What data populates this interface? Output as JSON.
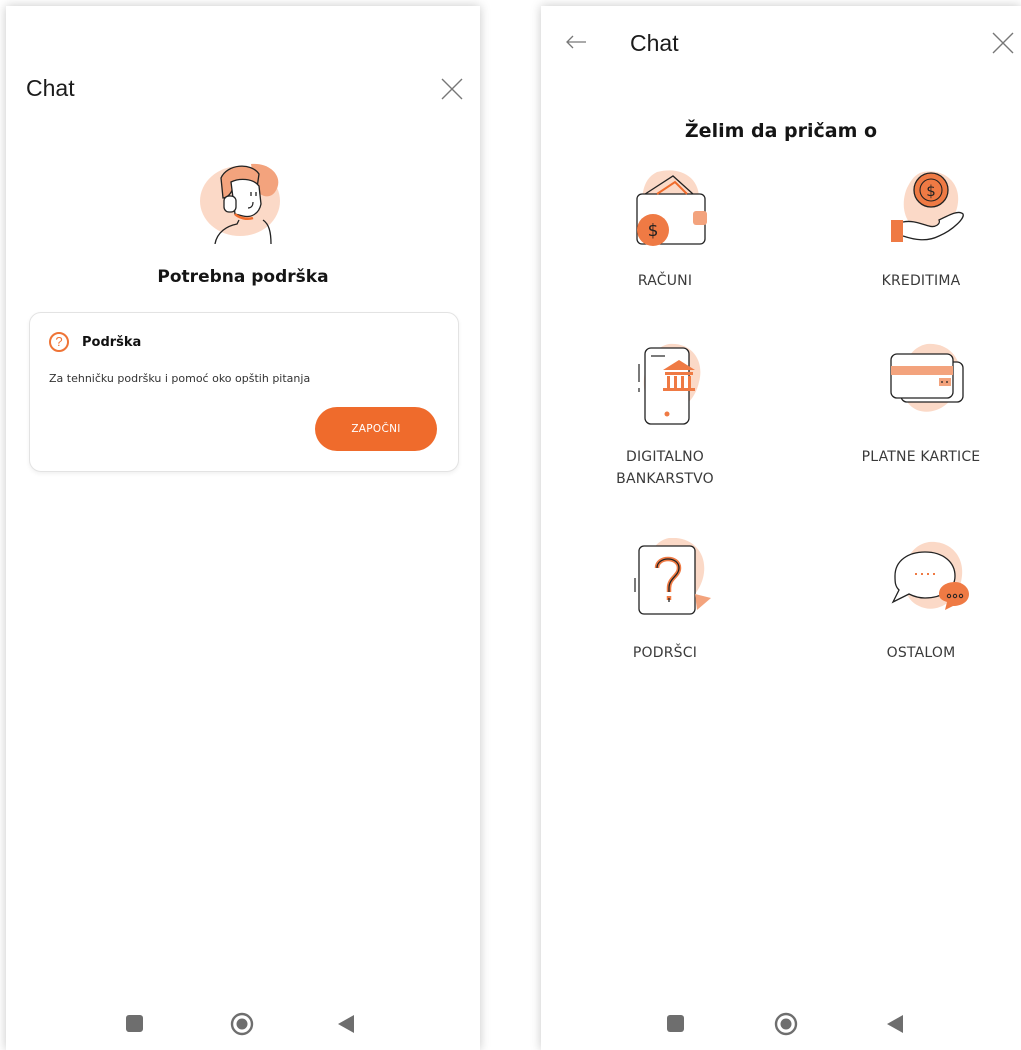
{
  "left_screen": {
    "header": {
      "title": "Chat"
    },
    "headline": "Potrebna podrška",
    "card": {
      "icon_text": "?",
      "title": "Podrška",
      "description": "Za tehničku podršku i pomoć oko opštih pitanja",
      "button_label": "ZAPOČNI"
    }
  },
  "right_screen": {
    "header": {
      "title": "Chat"
    },
    "headline": "Želim da pričam o",
    "topics": [
      {
        "label": "RAČUNI",
        "icon": "wallet-icon"
      },
      {
        "label": "KREDITIMA",
        "icon": "coin-hand-icon"
      },
      {
        "label": "DIGITALNO BANKARSTVO",
        "icon": "mobile-bank-icon"
      },
      {
        "label": "PLATNE KARTICE",
        "icon": "credit-card-icon"
      },
      {
        "label": "PODRŠCI",
        "icon": "question-icon"
      },
      {
        "label": "OSTALOM",
        "icon": "chat-bubble-icon"
      }
    ]
  },
  "icons": {
    "close": "close-icon",
    "back": "back-arrow-icon",
    "nav_recents": "square-icon",
    "nav_home": "circle-icon",
    "nav_back": "triangle-icon"
  },
  "colors": {
    "accent": "#ef6b2c",
    "accent_soft": "#fbd9c7"
  }
}
